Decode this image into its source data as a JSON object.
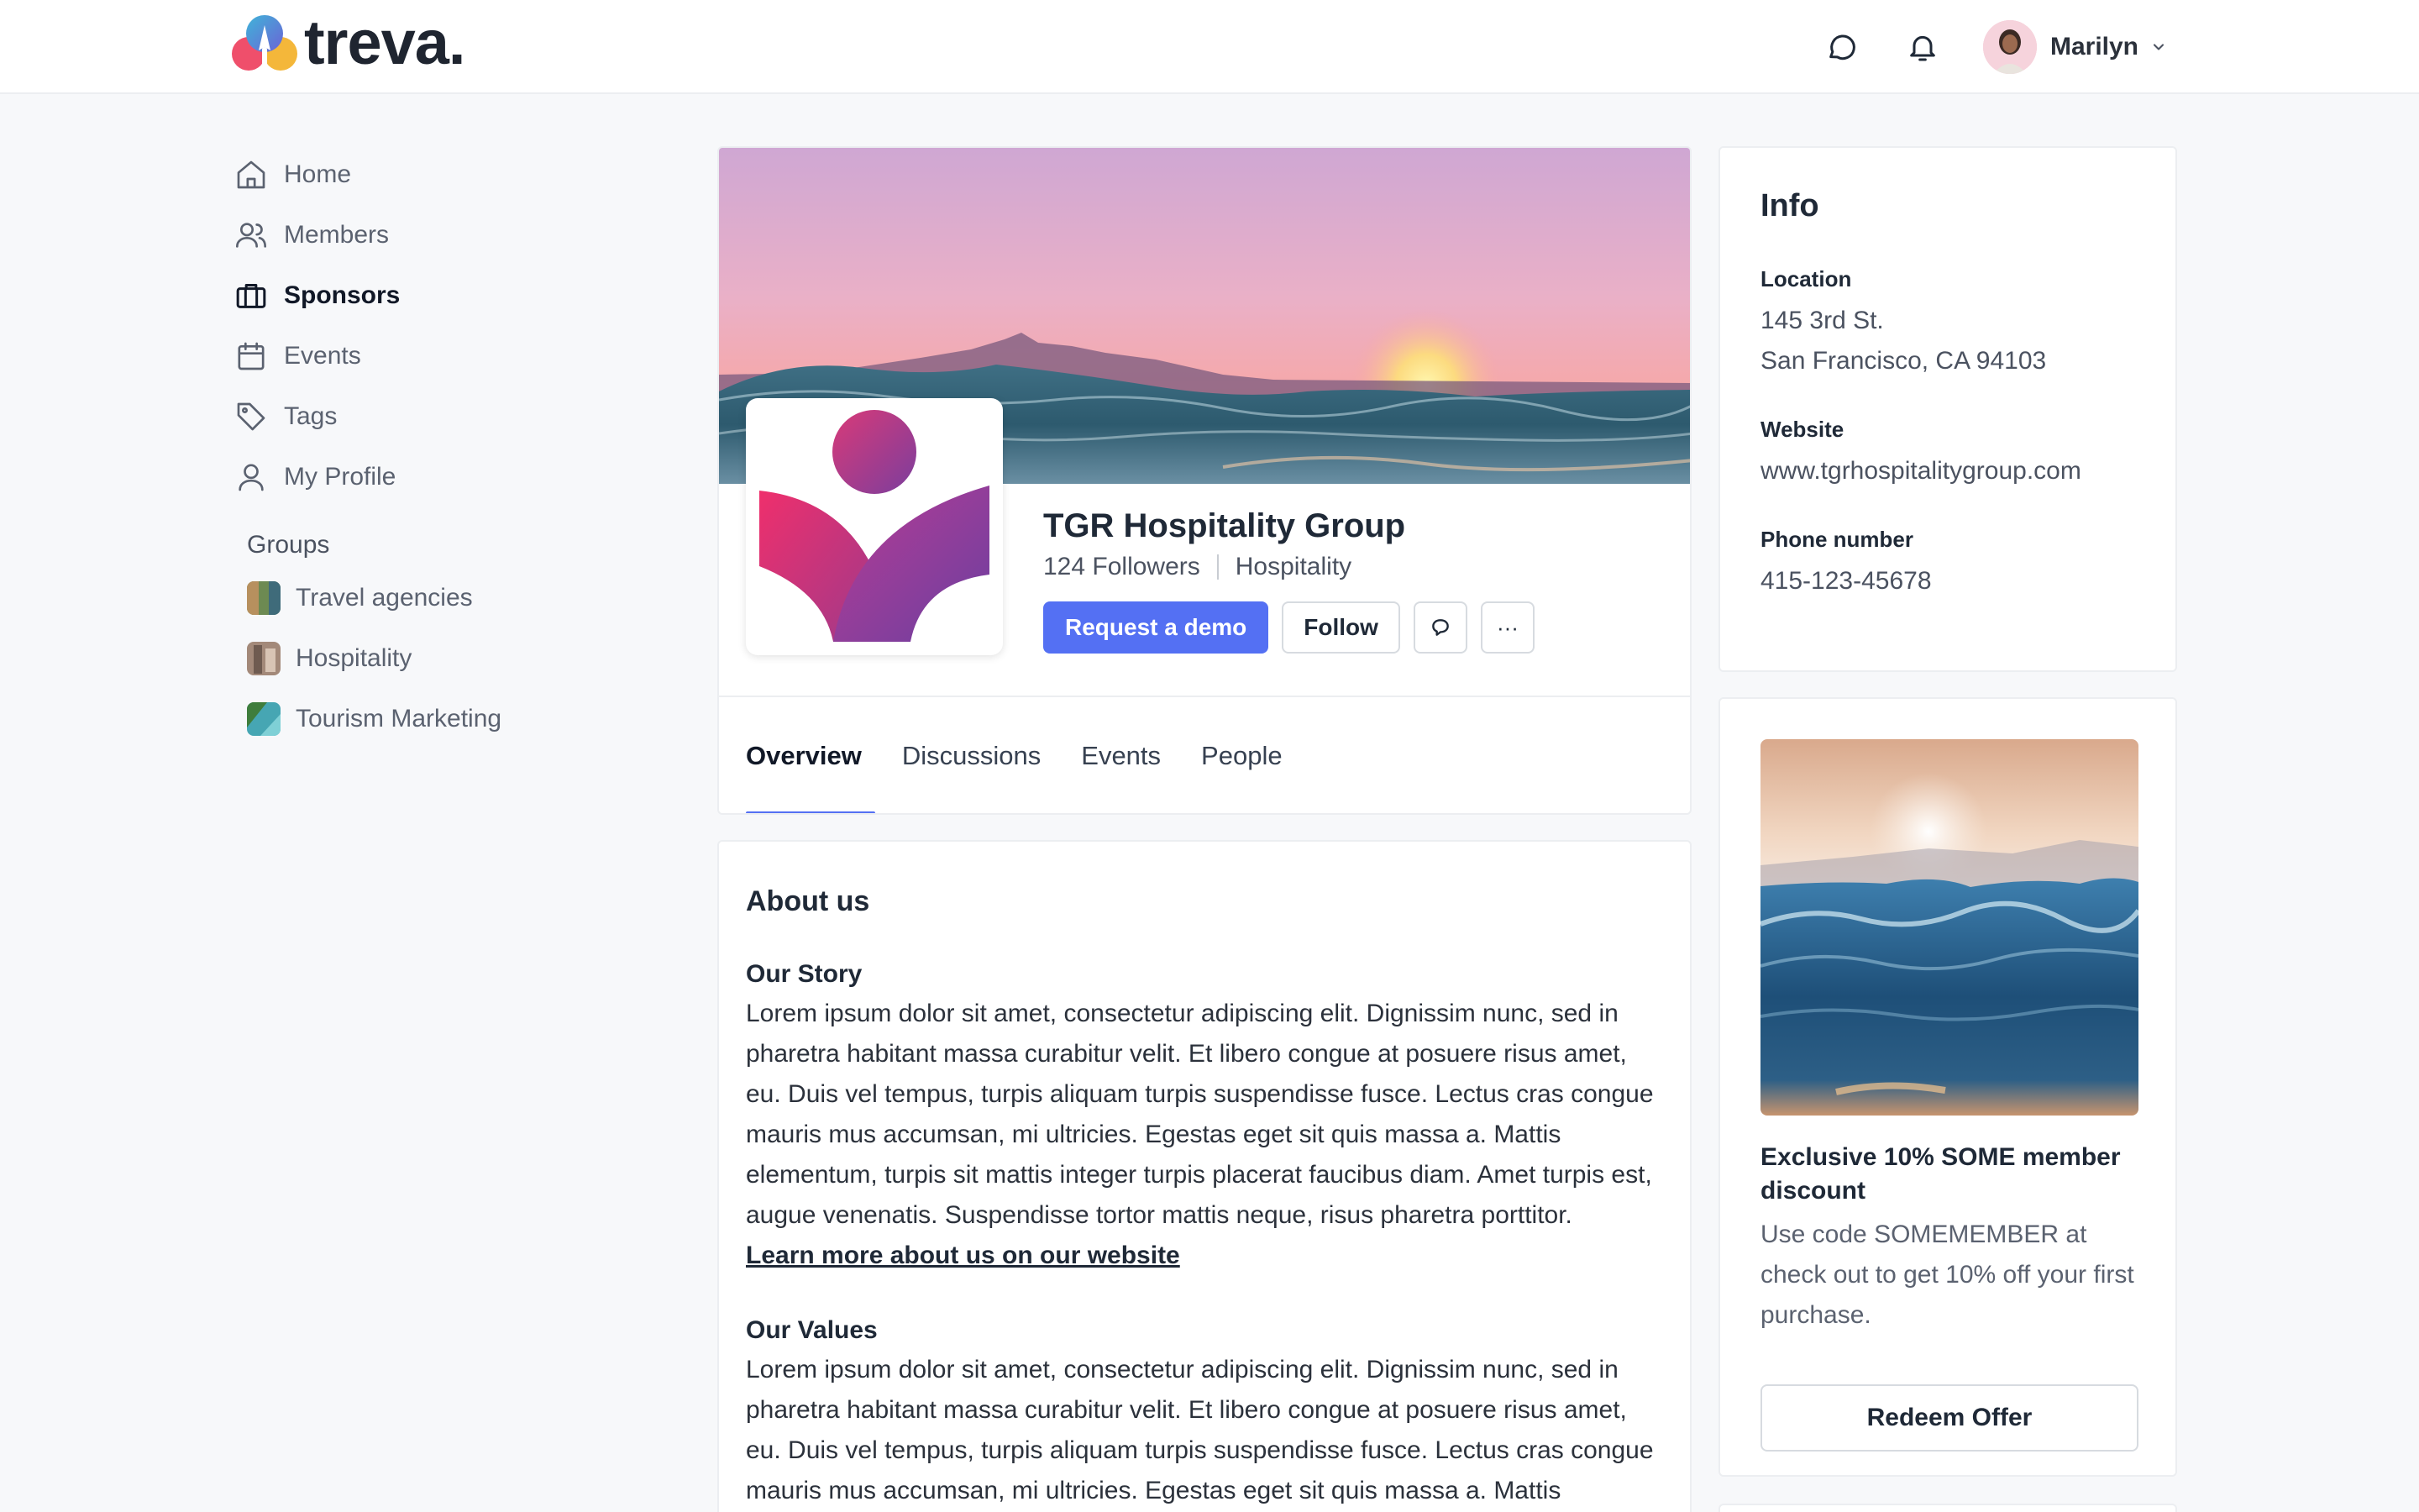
{
  "brand": {
    "name": "treva."
  },
  "header": {
    "user_name": "Marilyn"
  },
  "sidebar": {
    "items": [
      {
        "label": "Home",
        "icon": "home-icon",
        "active": false
      },
      {
        "label": "Members",
        "icon": "users-icon",
        "active": false
      },
      {
        "label": "Sponsors",
        "icon": "briefcase-icon",
        "active": true
      },
      {
        "label": "Events",
        "icon": "calendar-icon",
        "active": false
      },
      {
        "label": "Tags",
        "icon": "tag-icon",
        "active": false
      },
      {
        "label": "My Profile",
        "icon": "user-icon",
        "active": false
      }
    ],
    "groups_title": "Groups",
    "groups": [
      {
        "label": "Travel agencies"
      },
      {
        "label": "Hospitality"
      },
      {
        "label": "Tourism Marketing"
      }
    ]
  },
  "profile": {
    "name": "TGR Hospitality Group",
    "followers": "124 Followers",
    "category": "Hospitality",
    "request_demo_label": "Request a demo",
    "follow_label": "Follow",
    "more_label": "···",
    "tabs": [
      {
        "label": "Overview",
        "active": true
      },
      {
        "label": "Discussions",
        "active": false
      },
      {
        "label": "Events",
        "active": false
      },
      {
        "label": "People",
        "active": false
      }
    ]
  },
  "about": {
    "title": "About us",
    "story_title": "Our Story",
    "story_text": "Lorem ipsum dolor sit amet, consectetur adipiscing elit. Dignissim nunc, sed in pharetra habitant massa curabitur velit. Et libero congue at posuere risus amet, eu. Duis vel tempus, turpis aliquam turpis suspendisse fusce. Lectus cras congue mauris mus accumsan, mi ultricies. Egestas eget sit quis massa a. Mattis elementum, turpis sit mattis integer turpis placerat faucibus diam. Amet turpis est, augue venenatis. Suspendisse tortor mattis neque, risus pharetra porttitor.",
    "link_text": "Learn more about us on our website",
    "values_title": "Our Values",
    "values_text": "Lorem ipsum dolor sit amet, consectetur adipiscing elit. Dignissim nunc, sed in pharetra habitant massa curabitur velit. Et libero congue at posuere risus amet, eu. Duis vel tempus, turpis aliquam turpis suspendisse fusce. Lectus cras congue mauris mus accumsan, mi ultricies. Egestas eget sit quis massa a. Mattis"
  },
  "info": {
    "title": "Info",
    "location_label": "Location",
    "location_line1": "145 3rd St.",
    "location_line2": "San Francisco, CA 94103",
    "website_label": "Website",
    "website_value": "www.tgrhospitalitygroup.com",
    "phone_label": "Phone number",
    "phone_value": "415-123-45678"
  },
  "offer": {
    "title": "Exclusive 10% SOME member discount",
    "description": "Use code SOMEMEMBER at check out to get 10% off your first purchase.",
    "button_label": "Redeem Offer"
  },
  "colors": {
    "accent": "#5470f3",
    "background": "#f7f8fa"
  }
}
